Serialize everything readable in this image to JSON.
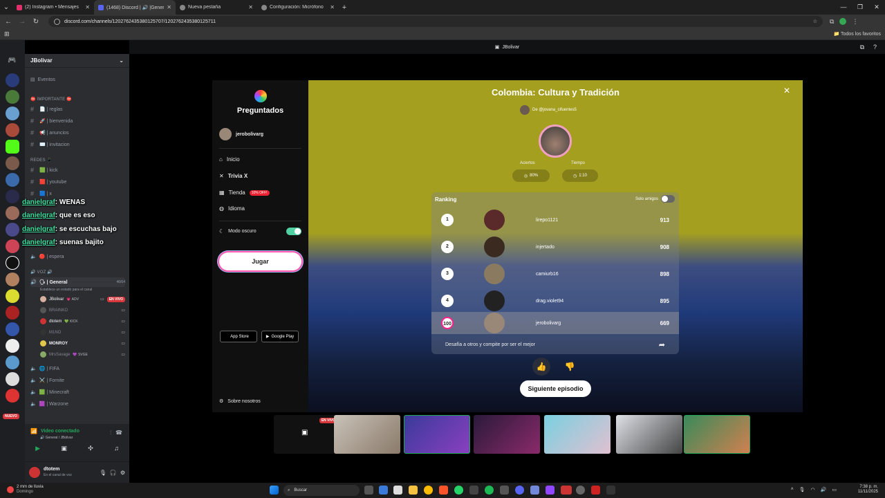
{
  "browser": {
    "tabs": [
      {
        "title": "(2) Instagram • Mensajes",
        "color": "#e1306c"
      },
      {
        "title": "(1468) Discord | 🔊 |General",
        "color": "#5865f2"
      },
      {
        "title": "Nueva pestaña",
        "color": "#888888"
      },
      {
        "title": "Configuración: Micrófono",
        "color": "#888888"
      }
    ],
    "url": "discord.com/channels/1202762435380125707/1202762435380125711",
    "bookmarks_label": "Todos los favoritos"
  },
  "discord": {
    "guild_name": "JBolivar",
    "events": "Eventos",
    "categories": {
      "importante": "⛔ IMPORTANTE ⛔",
      "redes": "REDES 📱",
      "voz": "🔊 VOZ 🔊"
    },
    "text_channels": [
      "📄 | reglas",
      "🚀 | bienvenida",
      "📢 | anuncios",
      "✉️ | invitacion",
      "🟩 | kick",
      "🟥 | youtube",
      "🟦 | x"
    ],
    "espera": "🔴 | espera",
    "voice_general": "🗣 | General",
    "voice_general_count": "46/64",
    "voice_status": "Establece un estado para el canal",
    "voice_users": [
      {
        "name": "JBolivar",
        "tag": "💗 ADV",
        "live": "EN VIVO",
        "color": "#d8b0a0"
      },
      {
        "name": "BRAINKO",
        "tag": "",
        "live": "",
        "color": "#555"
      },
      {
        "name": "dtotem",
        "tag": "💚 KICK",
        "live": "",
        "color": "#c33"
      },
      {
        "name": "M1NO",
        "tag": "",
        "live": "",
        "color": "#333"
      },
      {
        "name": "MONROY",
        "tag": "",
        "live": "",
        "color": "#e2c84a"
      },
      {
        "name": "MrsSavage",
        "tag": "💜 SVGE",
        "live": "",
        "color": "#8a6"
      }
    ],
    "other_voice": [
      "🌐 | FIFA",
      "⚔️ | Fornite",
      "🟩 | Minecraft",
      "🟪 | Warzone"
    ],
    "voice_connected": "Video conectado",
    "voice_connected_sub": "🔊 General / JBolivar",
    "user": {
      "name": "dtotem",
      "status": "En el canal de voz"
    },
    "nuevo": "NUEVO"
  },
  "chat_overlay": [
    {
      "user": "danielgraf",
      "text": ": WENAS"
    },
    {
      "user": "danielgraf",
      "text": ": que es eso"
    },
    {
      "user": "danielgraf",
      "text": ": se escuchas bajo"
    },
    {
      "user": "danielgraf",
      "text": ": suenas bajito"
    }
  ],
  "stream": {
    "streamer": "JBolivar",
    "live_badge": "EN VIVO"
  },
  "trivia": {
    "brand": "Preguntados",
    "player": "jerobolivarg",
    "menu": [
      "Inicio",
      "Trivia X",
      "Tienda",
      "Idioma"
    ],
    "shop_badge": "10% OFF!",
    "dark_mode": "Modo oscuro",
    "play": "Jugar",
    "app_store": "App Store",
    "google_play": "Google Play",
    "about": "Sobre nosotros",
    "title": "Colombia: Cultura y Tradición",
    "author": "De @jovana_cifuentes5",
    "aciertos_label": "Aciertos",
    "aciertos_value": "80%",
    "tiempo_label": "Tiempo",
    "tiempo_value": "1:10",
    "ranking_title": "Ranking",
    "solo_amigos": "Solo amigos",
    "ranking": [
      {
        "pos": "1",
        "name": "lirepo1121",
        "score": "913",
        "color": "#5a2a2a"
      },
      {
        "pos": "2",
        "name": "injertado",
        "score": "908",
        "color": "#3a2a20"
      },
      {
        "pos": "3",
        "name": "camiurb16",
        "score": "898",
        "color": "#8a7a60"
      },
      {
        "pos": "4",
        "name": "drag.violet94",
        "score": "895",
        "color": "#222"
      },
      {
        "pos": "100",
        "name": "jerobolivarg",
        "score": "669",
        "color": "#998877"
      }
    ],
    "challenge": "Desafía a otros y compite por ser el mejor",
    "next": "Siguiente episodio"
  },
  "taskbar": {
    "weather": "2 mm de lluvia",
    "weather_sub": "Domingo",
    "search": "Buscar",
    "time": "7:38 p. m.",
    "date": "11/11/2025"
  }
}
